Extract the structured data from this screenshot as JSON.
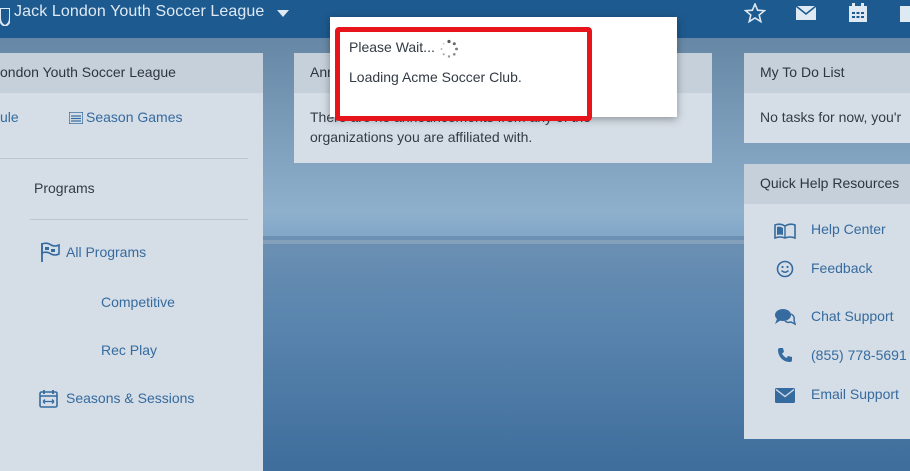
{
  "topbar": {
    "org_title": "Jack London Youth Soccer League",
    "icons": [
      "shield-icon",
      "chevron-down-icon",
      "star-icon",
      "mail-icon",
      "calendar-icon"
    ]
  },
  "left_panel": {
    "header": "ondon Youth Soccer League",
    "links": {
      "schedule": "ule",
      "season_games": "Season Games"
    },
    "programs_heading": "Programs",
    "all_programs": "All Programs",
    "competitive": "Competitive",
    "rec_play": "Rec Play",
    "seasons_sessions": "Seasons & Sessions"
  },
  "announcements": {
    "header": "Ann",
    "body_line1": "There are no announcements from any of the",
    "body_line2": "organizations you are affiliated with."
  },
  "todo": {
    "header": "My To Do List",
    "body": "No tasks for now, you'r"
  },
  "quick_help": {
    "header": "Quick Help Resources",
    "items": [
      "Help Center",
      "Feedback",
      "Chat Support",
      "(855) 778-5691",
      "Email Support"
    ]
  },
  "modal": {
    "title": "Please Wait...",
    "message": "Loading Acme Soccer Club."
  },
  "colors": {
    "topbar": "#1d5a8f",
    "link": "#356b9f",
    "highlight": "#e8141b"
  }
}
